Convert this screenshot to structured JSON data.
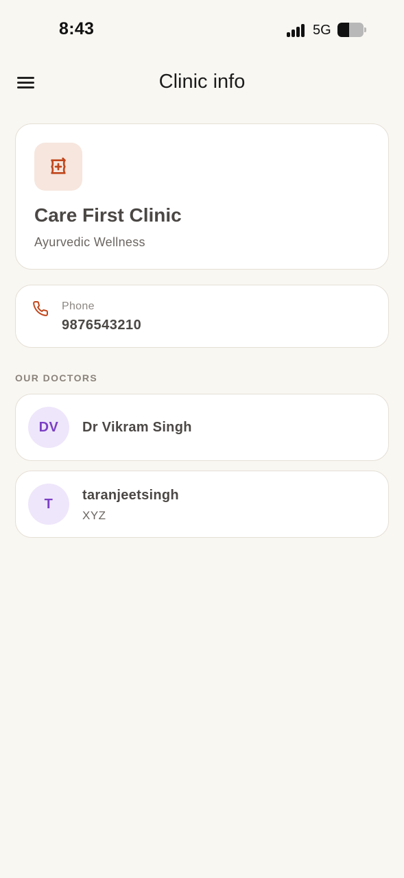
{
  "status_bar": {
    "time": "8:43",
    "network": "5G",
    "battery_level": 0.45
  },
  "header": {
    "title": "Clinic info",
    "menu_icon": "hamburger-menu-icon"
  },
  "clinic": {
    "icon": "mortar-pestle-medical-icon",
    "name": "Care First Clinic",
    "type": "Ayurvedic Wellness"
  },
  "contact": {
    "icon": "phone-icon",
    "label": "Phone",
    "value": "9876543210"
  },
  "doctors_section": {
    "heading": "OUR DOCTORS",
    "doctors": [
      {
        "initials": "DV",
        "name": "Dr Vikram Singh",
        "specialty": ""
      },
      {
        "initials": "T",
        "name": "taranjeetsingh",
        "specialty": "XYZ"
      }
    ]
  },
  "colors": {
    "accent": "#c0461b",
    "icon_bg": "#f6e6de",
    "avatar_bg": "#eee6fb",
    "avatar_text": "#7b3fc4",
    "background": "#f9f7f2"
  }
}
